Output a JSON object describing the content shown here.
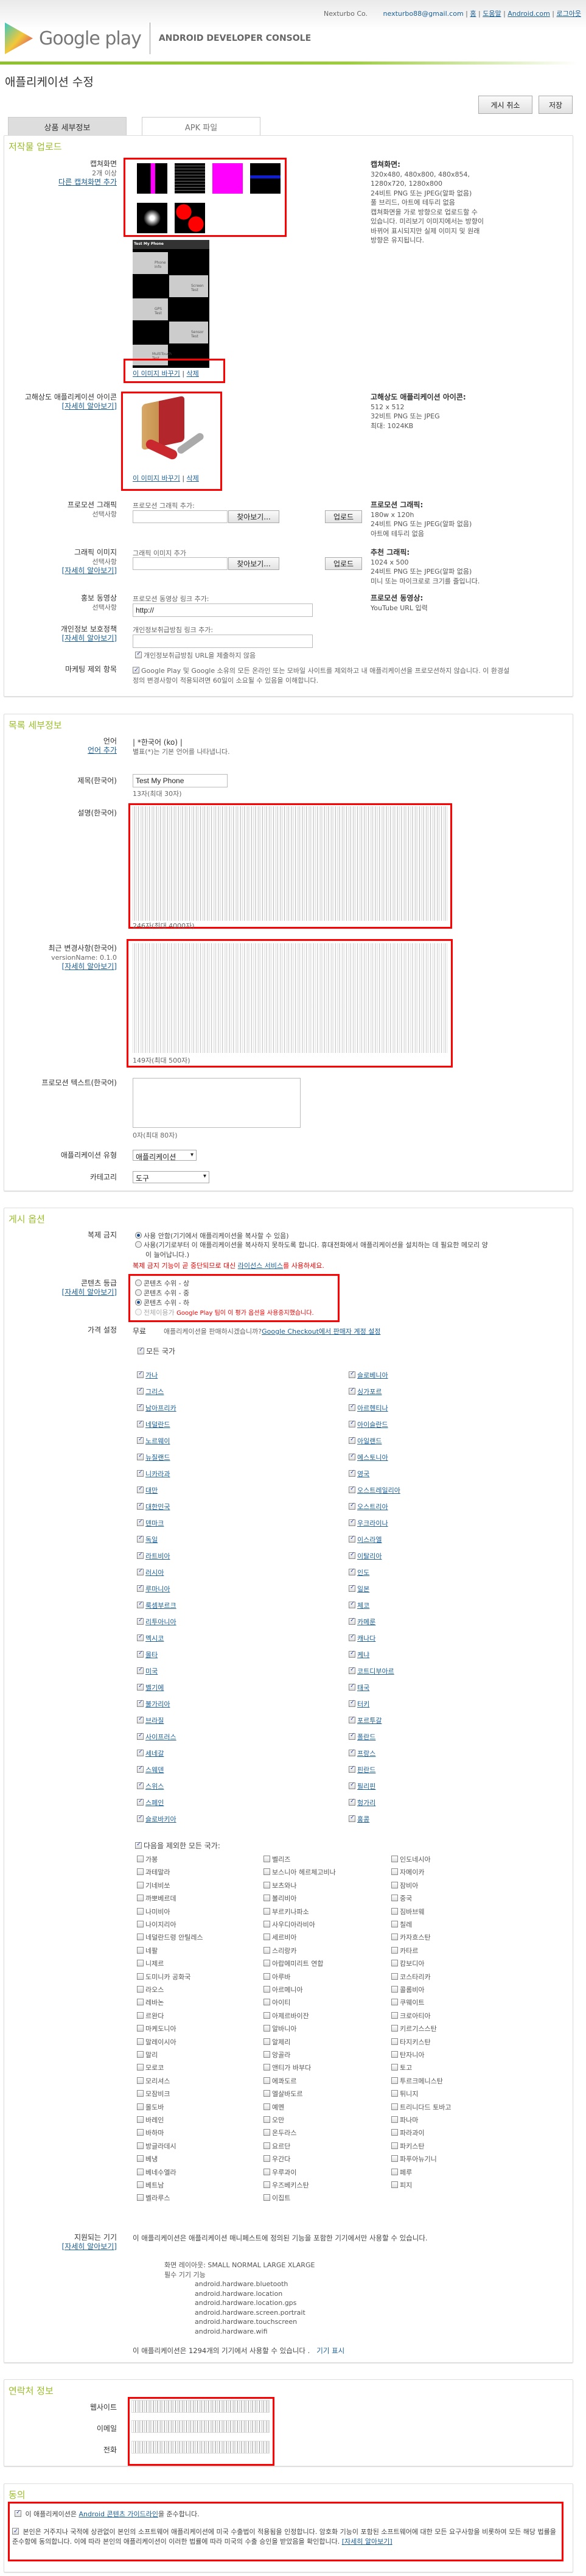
{
  "header": {
    "company": "Nexturbo Co.",
    "email": "nexturbo88@gmail.com",
    "links": [
      "홈",
      "도움말",
      "Android.com",
      "로그아웃"
    ],
    "logo_text": "Google play",
    "console": "ANDROID DEVELOPER CONSOLE"
  },
  "page_title": "애플리케이션 수정",
  "actions": {
    "unpublish": "게시 취소",
    "save": "저장"
  },
  "tabs": [
    "상품 세부정보",
    "APK 파일"
  ],
  "upload": {
    "heading": "저작물 업로드",
    "screens_label": "캡쳐화면",
    "screens_sub": "2개 이상",
    "screens_add": "다른 캡쳐화면 추가",
    "replace": "이 이미지 바꾸기",
    "delete": "삭제",
    "screens_info": {
      "title": "캡쳐화면:",
      "lines": [
        "320x480, 480x800, 480x854,",
        "1280x720, 1280x800",
        "24비트 PNG 또는 JPEG(알파 없음)",
        "풀 브리드, 아트에 테두리 없음",
        "캡쳐화면을 가로 방향으로 업로드할 수",
        "있습니다. 미리보기 이미지에서는 방향이",
        "바뀌어 표시되지만 실제 이미지 및 원래",
        "방향은 유지됩니다."
      ]
    },
    "composite_labels": [
      "Test My Phone",
      "Phone Info",
      "Screen Test",
      "GPS Test",
      "Sensor Test",
      "MultiTouch Test"
    ],
    "icon_label": "고해상도 애플리케이션 아이콘",
    "learn_more": "[자세히 알아보기]",
    "icon_info": {
      "title": "고해상도 애플리케이션 아이콘:",
      "lines": [
        "512 x 512",
        "32비트 PNG 또는 JPEG",
        "최대: 1024KB"
      ]
    },
    "promo": {
      "label": "프로모션 그래픽",
      "optional": "선택사항",
      "add": "프로모션 그래픽 추가:",
      "browse": "찾아보기...",
      "upload": "업로드",
      "info_title": "프로모션 그래픽:",
      "info": [
        "180w x 120h",
        "24비트 PNG 또는 JPEG(알파 없음)",
        "아트에 테두리 없음"
      ]
    },
    "feature": {
      "label": "그래픽 이미지",
      "optional": "선택사항",
      "add": "그래픽 이미지 추가",
      "browse": "찾아보기...",
      "upload": "업로드",
      "info_title": "추천 그래픽:",
      "info": [
        "1024 x 500",
        "24비트 PNG 또는 JPEG(알파 없음)",
        "미니 또는 마이크로로 크기를 줄입니다."
      ]
    },
    "video": {
      "label": "홍보 동영상",
      "optional": "선택사항",
      "add": "프로모션 동영상 링크 추가:",
      "value": "http://",
      "info_title": "프로모션 동영상:",
      "info": "YouTube URL 입력"
    },
    "privacy": {
      "label": "개인정보 보호정책",
      "add": "개인정보취급방침 링크 추가:",
      "value": "",
      "checkbox": "개인정보취급방침 URL을 제출하지 않음",
      "checked": true
    },
    "marketing": {
      "label": "마케팅 제외 항목",
      "text": "Google Play 및 Google 소유의 모든 온라인 또는 모바일 사이트를 제외하고 내 애플리케이션을 프로모션하지 않습니다. 이 환경설정의 변경사항이 적용되려면 60일이 소요될 수 있음을 이해합니다.",
      "checked": true
    }
  },
  "listing": {
    "heading": "목록 세부정보",
    "language_label": "언어",
    "add_language": "언어 추가",
    "language_value": "| *한국어 (ko) |",
    "language_note": "별표(*)는 기본 언어를 나타냅니다.",
    "title_label": "제목(한국어)",
    "title_value": "Test My Phone",
    "title_count": "13자(최대 30자)",
    "desc_label": "설명(한국어)",
    "desc_count": "246자(최대 4000자)",
    "recent_label": "최근 변경사항(한국어)",
    "version": "versionName: 0.1.0",
    "recent_count": "149자(최대 500자)",
    "promo_text_label": "프로모션 텍스트(한국어)",
    "promo_text_value": "",
    "promo_text_count": "0자(최대 80자)",
    "type_label": "애플리케이션 유형",
    "type_value": "애플리케이션",
    "category_label": "카테고리",
    "category_value": "도구"
  },
  "publishing": {
    "heading": "게시 옵션",
    "copy_label": "복제 금지",
    "copy_off": "사용 안함(기기에서 애플리케이션을 복사할 수 있음)",
    "copy_on": "사용(기기로부터 이 애플리케이션을 복사하지 못하도록 합니다. 휴대전화에서 애플리케이션을 설치하는 데 필요한 메모리 양이 늘어납니다.)",
    "copy_warning_pre": "복제 금지 기능이 곧 중단되므로 대신 ",
    "copy_warning_link": "라이선스 서비스",
    "copy_warning_post": "를 사용하세요.",
    "rating_label": "콘텐츠 등급",
    "ratings": [
      "콘텐츠 수위 - 상",
      "콘텐츠 수위 - 중",
      "콘텐츠 수위 - 하",
      "전체이용가"
    ],
    "rating_selected": 2,
    "rating_note": "Google Play 팀이 이 평가 옵션을 사용중지했습니다.",
    "price_label": "가격 설정",
    "price_value": "무료",
    "sell_q": "애플리케이션을 판매하시겠습니까?",
    "sell_link": "Google Checkout에서 판매자 계정 설정",
    "all_countries": "모든 국가",
    "countries_left": [
      "가나",
      "그리스",
      "남아프리카",
      "네덜란드",
      "노르웨이",
      "뉴질랜드",
      "니카라과",
      "대만",
      "대한민국",
      "덴마크",
      "독일",
      "라트비아",
      "러시아",
      "루마니아",
      "룩셈부르크",
      "리투아니아",
      "멕시코",
      "몰타",
      "미국",
      "벨기에",
      "불가리아",
      "브라질",
      "사이프러스",
      "세네갈",
      "스웨덴",
      "스위스",
      "스페인",
      "슬로바키아"
    ],
    "countries_right": [
      "슬로베니아",
      "싱가포르",
      "아르헨티나",
      "아이슬란드",
      "아일랜드",
      "에스토니아",
      "영국",
      "오스트레일리아",
      "오스트리아",
      "우크라이나",
      "이스라엘",
      "이탈리아",
      "인도",
      "일본",
      "체코",
      "카메룬",
      "캐나다",
      "케냐",
      "코트디부아르",
      "태국",
      "터키",
      "포르투갈",
      "폴란드",
      "프랑스",
      "핀란드",
      "필리핀",
      "헝가리",
      "홍콩"
    ],
    "except_label": "다음을 제외한 모든 국가:",
    "except_cols": [
      [
        "가봉",
        "과테말라",
        "기네비쏘",
        "까뽀베르데",
        "나미비아",
        "나이지리아",
        "네덜란드령 안틸레스",
        "네팔",
        "니제르",
        "도미니카 공화국",
        "라오스",
        "레바논",
        "르완다",
        "마케도니아",
        "말레이시아",
        "말리",
        "모로코",
        "모리셔스",
        "모잠비크",
        "몰도바",
        "바레인",
        "바하마",
        "방글라데시",
        "베냉",
        "베네수엘라",
        "베트남",
        "벨라루스"
      ],
      [
        "벨리즈",
        "보스니아 헤르체고비나",
        "보츠와나",
        "볼리비아",
        "부르키나파소",
        "사우디아라비아",
        "세르비아",
        "스리랑카",
        "아랍에미리트 연합",
        "아루바",
        "아르메니아",
        "아이티",
        "아제르바이잔",
        "알바니아",
        "알제리",
        "앙골라",
        "앤티가 바부다",
        "에콰도르",
        "엘살바도르",
        "예멘",
        "오만",
        "온두라스",
        "요르단",
        "우간다",
        "우루과이",
        "우즈베키스탄",
        "이집트"
      ],
      [
        "인도네시아",
        "자메이카",
        "잠비아",
        "중국",
        "짐바브웨",
        "칠레",
        "카자흐스탄",
        "카타르",
        "캄보디아",
        "코스타리카",
        "콜롬비아",
        "쿠웨이트",
        "크로아티아",
        "키르기스스탄",
        "타지키스탄",
        "탄자니아",
        "토고",
        "투르크메니스탄",
        "튀니지",
        "트리니다드 토바고",
        "파나마",
        "파라과이",
        "파키스탄",
        "파푸아뉴기니",
        "페루",
        "피지"
      ]
    ],
    "devices_label": "지원되는 기기",
    "devices_text": "이 애플리케이션은 애플리케이션 매니페스트에 정의된 기능을 포함한 기기에서만 사용할 수 있습니다.",
    "screen_layout": "화면 레이아웃: SMALL NORMAL LARGE XLARGE",
    "required_features": "필수 기기 기능",
    "features": [
      "android.hardware.bluetooth",
      "android.hardware.location",
      "android.hardware.location.gps",
      "android.hardware.screen.portrait",
      "android.hardware.touchscreen",
      "android.hardware.wifi"
    ],
    "device_count_text": "이 애플리케이션은 1294개의 기기에서 사용할 수 있습니다 .",
    "show_devices": "기기 표시"
  },
  "contact": {
    "heading": "연락처 정보",
    "website": "웹사이트",
    "email": "이메일",
    "phone": "전화"
  },
  "consent": {
    "heading": "동의",
    "c1_pre": "이 애플리케이션은 ",
    "c1_link": "Android 콘텐츠 가이드라인",
    "c1_post": "을 준수합니다.",
    "c2": "본인은 거주지나 국적에 상관없이 본인의 소프트웨어 애플리케이션에 미국 수출법이 적용됨을 인정합니다. 암호화 기능이 포함된 소프트웨어에 대한 모든 요구사항을 비롯하여 모든 해당 법률을 준수함에 동의합니다. 이에 따라 본인의 애플리케이션이 이러한 법률에 따라 미국의 수출 승인을 받았음을 확인합니다. ",
    "learn_more": "[자세히 알아보기]"
  },
  "colors": {
    "accent_green": "#9bbf2a",
    "link": "#1b5f95",
    "highlight": "#ff0000"
  }
}
